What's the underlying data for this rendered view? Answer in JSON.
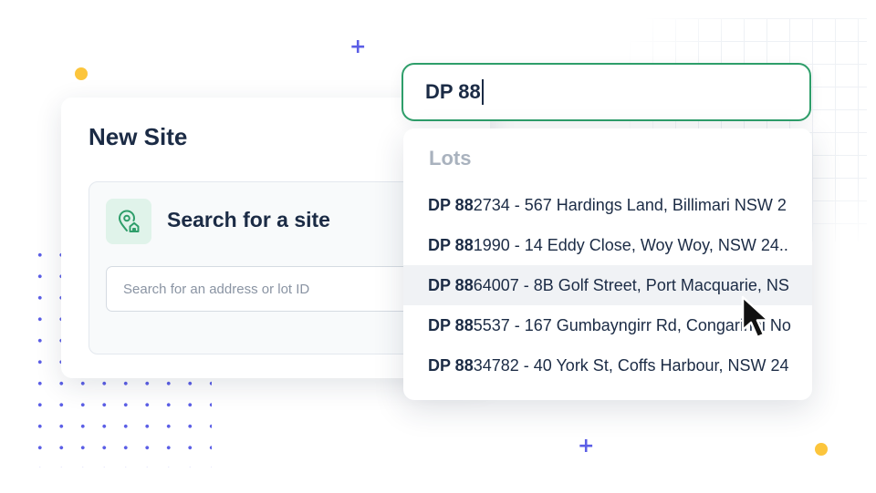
{
  "card": {
    "title": "New Site",
    "section_title": "Search for a site",
    "search_placeholder": "Search for an address or lot ID"
  },
  "query": {
    "value": "DP 88"
  },
  "dropdown": {
    "heading": "Lots",
    "items": [
      {
        "match": "DP 88",
        "rest": "2734 - 567 Hardings Land, Billimari NSW 2"
      },
      {
        "match": "DP 88",
        "rest": "1990 - 14 Eddy Close, Woy Woy, NSW 24.."
      },
      {
        "match": "DP 88",
        "rest": "64007 - 8B Golf Street, Port Macquarie, NS"
      },
      {
        "match": "DP 88",
        "rest": "5537 - 167 Gumbayngirr Rd, Congarinni No"
      },
      {
        "match": "DP 88",
        "rest": "34782 - 40 York St, Coffs Harbour, NSW 24"
      }
    ],
    "hovered_index": 2
  },
  "colors": {
    "accent_green": "#2e9e6a",
    "text_dark": "#1b2b45",
    "decor_purple": "#5b5ee6",
    "decor_yellow": "#fcc53c"
  },
  "icons": [
    "location-home-icon",
    "mouse-pointer-icon",
    "plus-icon"
  ]
}
